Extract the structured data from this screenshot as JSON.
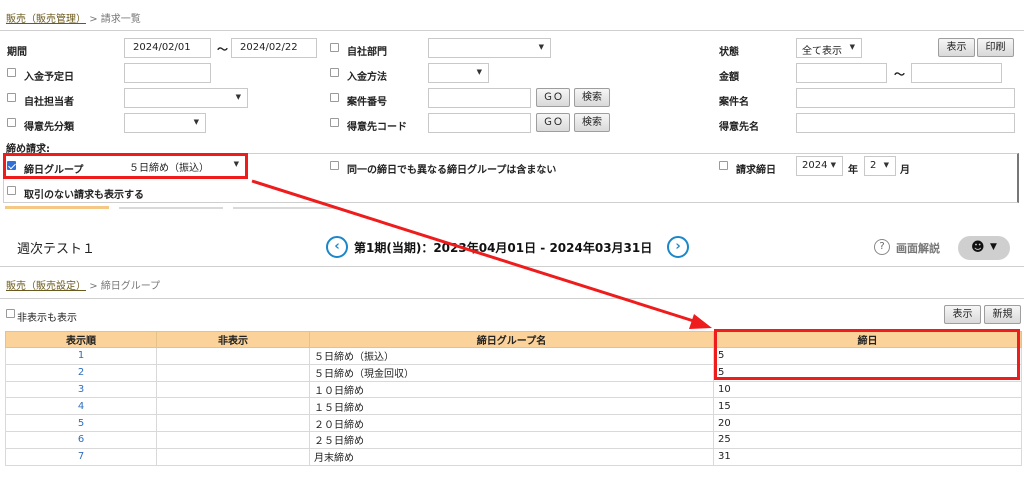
{
  "breadcrumb_top": {
    "parent": "販売（販売管理）",
    "sep": ">",
    "current": "請求一覧"
  },
  "filters": {
    "period_label": "期間",
    "period_from": "2024/02/01",
    "period_tilde": "〜",
    "period_to": "2024/02/22",
    "own_dept_label": "自社部門",
    "status_label": "状態",
    "status_value": "全て表示",
    "show_button": "表示",
    "print_button": "印刷",
    "payment_due_label": "入金予定日",
    "payment_method_label": "入金方法",
    "amount_label": "金額",
    "amount_tilde": "〜",
    "own_staff_label": "自社担当者",
    "case_number_label": "案件番号",
    "go_label": "ＧＯ",
    "search_label": "検索",
    "case_name_label": "案件名",
    "customer_class_label": "得意先分類",
    "customer_code_label": "得意先コード",
    "customer_name_label": "得意先名",
    "closing_section_label": "締め請求:",
    "closing_group_label": "締日グループ",
    "closing_group_value": "５日締め（振込）",
    "same_day_label": "同一の締日でも異なる締日グループは含まない",
    "billing_close_label": "請求締日",
    "billing_year": "2024",
    "year_suffix": "年",
    "billing_month": "2",
    "month_suffix": "月",
    "no_transaction_label": "取引のない請求も表示する"
  },
  "header_bar": {
    "company": "週次テスト１",
    "period_text": "第1期(当期)：2023年04月01日 - 2024年03月31日",
    "help_label": "画面解説",
    "prev_icon": "chevron-left-icon",
    "next_icon": "chevron-right-icon"
  },
  "breadcrumb_bottom": {
    "parent": "販売（販売設定）",
    "sep": ">",
    "current": "締日グループ"
  },
  "list": {
    "show_hidden_label": "非表示も表示",
    "show_button": "表示",
    "new_button": "新規",
    "columns": [
      "表示順",
      "非表示",
      "締日グループ名",
      "締日"
    ],
    "rows": [
      {
        "order": "1",
        "hidden": "",
        "name": "５日締め（振込）",
        "day": "5"
      },
      {
        "order": "2",
        "hidden": "",
        "name": "５日締め（現金回収）",
        "day": "5"
      },
      {
        "order": "3",
        "hidden": "",
        "name": "１０日締め",
        "day": "10"
      },
      {
        "order": "4",
        "hidden": "",
        "name": "１５日締め",
        "day": "15"
      },
      {
        "order": "5",
        "hidden": "",
        "name": "２０日締め",
        "day": "20"
      },
      {
        "order": "6",
        "hidden": "",
        "name": "２５日締め",
        "day": "25"
      },
      {
        "order": "7",
        "hidden": "",
        "name": "月末締め",
        "day": "31"
      }
    ]
  },
  "colors": {
    "annotation": "#ee1c1c",
    "table_header": "#fbd29a",
    "link": "#2f6fbf",
    "nav_circle": "#1b87c9"
  }
}
